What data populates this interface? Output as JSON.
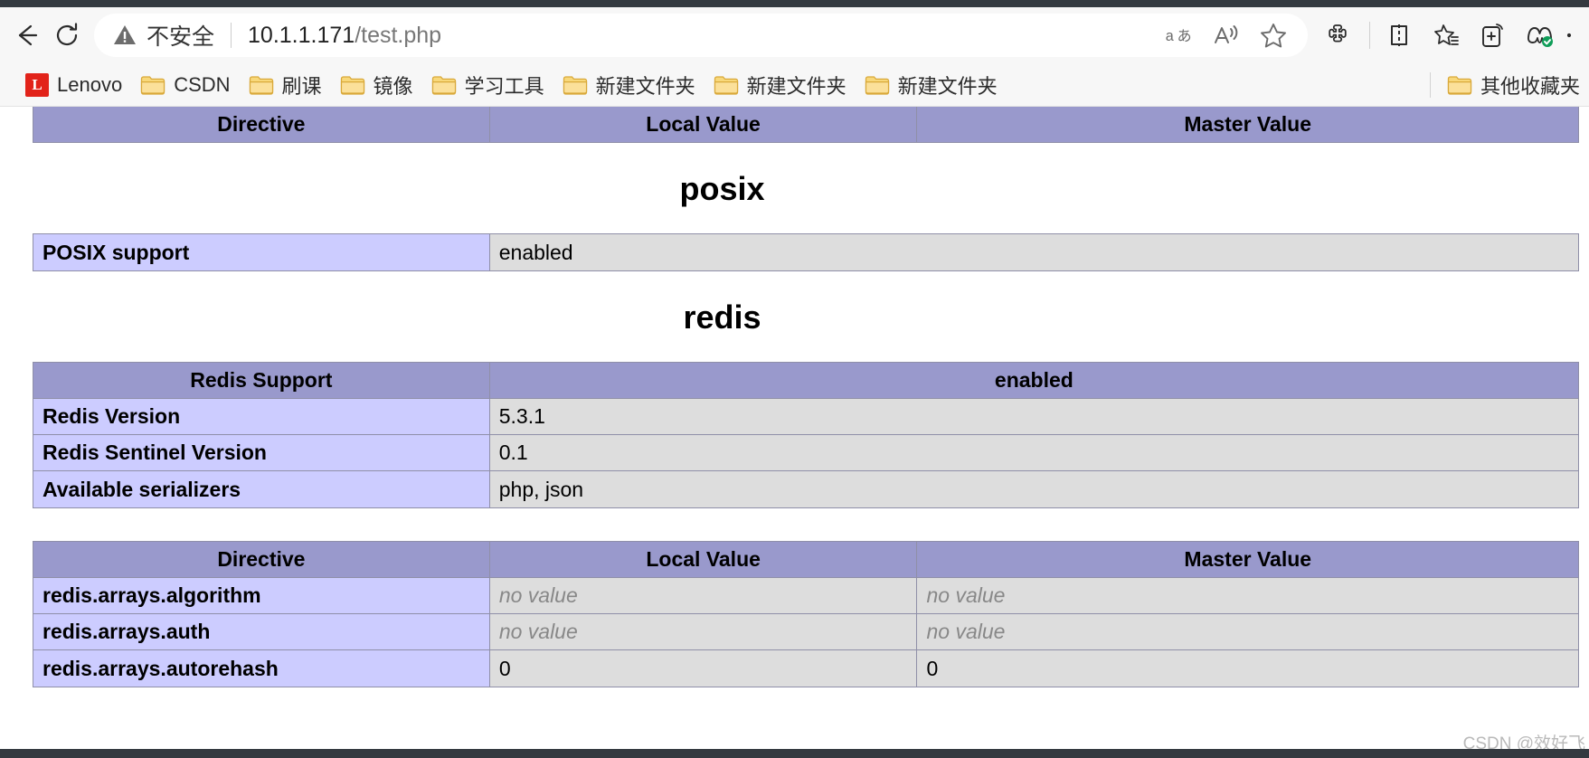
{
  "browser": {
    "back_label": "Back",
    "reload_label": "Refresh",
    "security_text": "不安全",
    "url_main": "10.1.1.171",
    "url_path": "/test.php",
    "omnibox_icons": [
      "translate-icon",
      "read-aloud-icon",
      "favorite-star-icon"
    ],
    "toolbar_icons": [
      "extensions-icon",
      "split-screen-icon",
      "collections-icon",
      "browser-essentials-icon",
      "copilot-icon"
    ]
  },
  "bookmarks": {
    "items": [
      {
        "label": "Lenovo",
        "icon": "lenovo-icon"
      },
      {
        "label": "CSDN",
        "icon": "folder-icon"
      },
      {
        "label": "刷课",
        "icon": "folder-icon"
      },
      {
        "label": "镜像",
        "icon": "folder-icon"
      },
      {
        "label": "学习工具",
        "icon": "folder-icon"
      },
      {
        "label": "新建文件夹",
        "icon": "folder-icon"
      },
      {
        "label": "新建文件夹",
        "icon": "folder-icon"
      },
      {
        "label": "新建文件夹",
        "icon": "folder-icon"
      }
    ],
    "other_favorites": {
      "label": "其他收藏夹",
      "icon": "folder-icon"
    }
  },
  "content": {
    "top_table": {
      "headers": [
        "Directive",
        "Local Value",
        "Master Value"
      ]
    },
    "posix": {
      "title": "posix",
      "rows": [
        {
          "key": "POSIX support",
          "value": "enabled"
        }
      ]
    },
    "redis": {
      "title": "redis",
      "summary": {
        "header_key": "Redis Support",
        "header_value": "enabled",
        "rows": [
          {
            "key": "Redis Version",
            "value": "5.3.1"
          },
          {
            "key": "Redis Sentinel Version",
            "value": "0.1"
          },
          {
            "key": "Available serializers",
            "value": "php, json"
          }
        ]
      },
      "directives": {
        "headers": [
          "Directive",
          "Local Value",
          "Master Value"
        ],
        "rows": [
          {
            "name": "redis.arrays.algorithm",
            "local": "no value",
            "master": "no value",
            "local_novalue": true,
            "master_novalue": true
          },
          {
            "name": "redis.arrays.auth",
            "local": "no value",
            "master": "no value",
            "local_novalue": true,
            "master_novalue": true
          },
          {
            "name": "redis.arrays.autorehash",
            "local": "0",
            "master": "0",
            "local_novalue": false,
            "master_novalue": false
          }
        ]
      }
    },
    "watermark": "CSDN @效好飞"
  },
  "colors": {
    "header_purple": "#9999cc",
    "key_lavender": "#ccccff",
    "value_gray": "#dddddd",
    "border": "#8f8fa8",
    "chrome_bg": "#f7f7f7",
    "lenovo_red": "#e2231a",
    "folder_yellow": "#f5c84c"
  }
}
